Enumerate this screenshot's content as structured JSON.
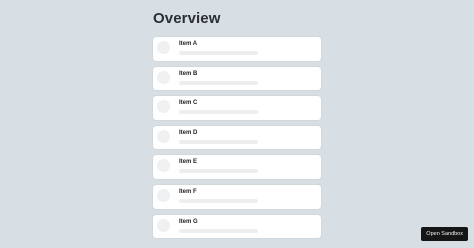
{
  "page": {
    "title": "Overview"
  },
  "items": [
    {
      "label": "Item A"
    },
    {
      "label": "Item B"
    },
    {
      "label": "Item C"
    },
    {
      "label": "Item D"
    },
    {
      "label": "Item E"
    },
    {
      "label": "Item F"
    },
    {
      "label": "Item G"
    }
  ],
  "sandbox_button": {
    "label": "Open Sandbox"
  },
  "colors": {
    "background": "#d8dfe4",
    "card": "#ffffff",
    "placeholder": "#eceef0",
    "button": "#151515"
  }
}
